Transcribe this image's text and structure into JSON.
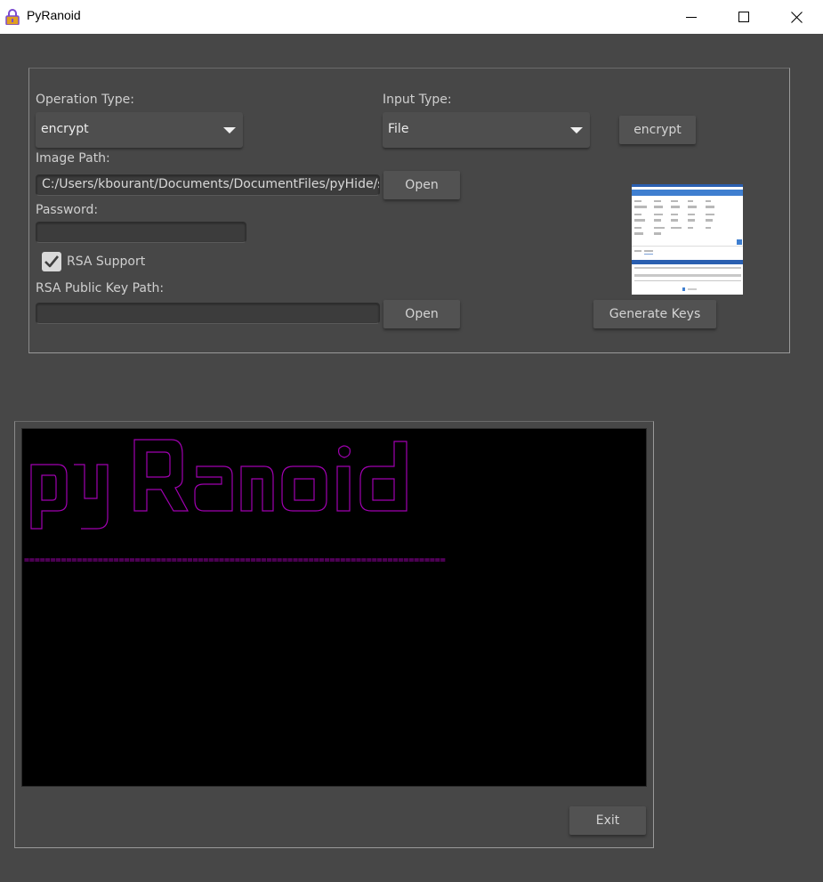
{
  "window": {
    "title": "PyRanoid",
    "app_icon": "padlock-icon",
    "controls": [
      "minimize-icon",
      "maximize-icon",
      "close-icon"
    ]
  },
  "form": {
    "operation_type": {
      "label": "Operation Type:",
      "value": "encrypt"
    },
    "input_type": {
      "label": "Input Type:",
      "value": "File"
    },
    "action_button": "encrypt",
    "image_path": {
      "label": "Image Path:",
      "value": "C:/Users/kbourant/Documents/DocumentFiles/pyHide/s",
      "open_label": "Open"
    },
    "password": {
      "label": "Password:",
      "value": ""
    },
    "rsa_support": {
      "label": "RSA Support",
      "checked": true
    },
    "rsa_public_key_path": {
      "label": "RSA Public Key Path:",
      "value": "",
      "open_label": "Open"
    },
    "generate_keys_label": "Generate Keys"
  },
  "console": {
    "banner_text": "pyRanoid",
    "separator": "================================================================================",
    "text_color": "#b000c0"
  },
  "footer": {
    "exit_label": "Exit"
  },
  "colors": {
    "window_bg": "#474747",
    "console_bg": "#000000",
    "accent": "#b000c0"
  }
}
